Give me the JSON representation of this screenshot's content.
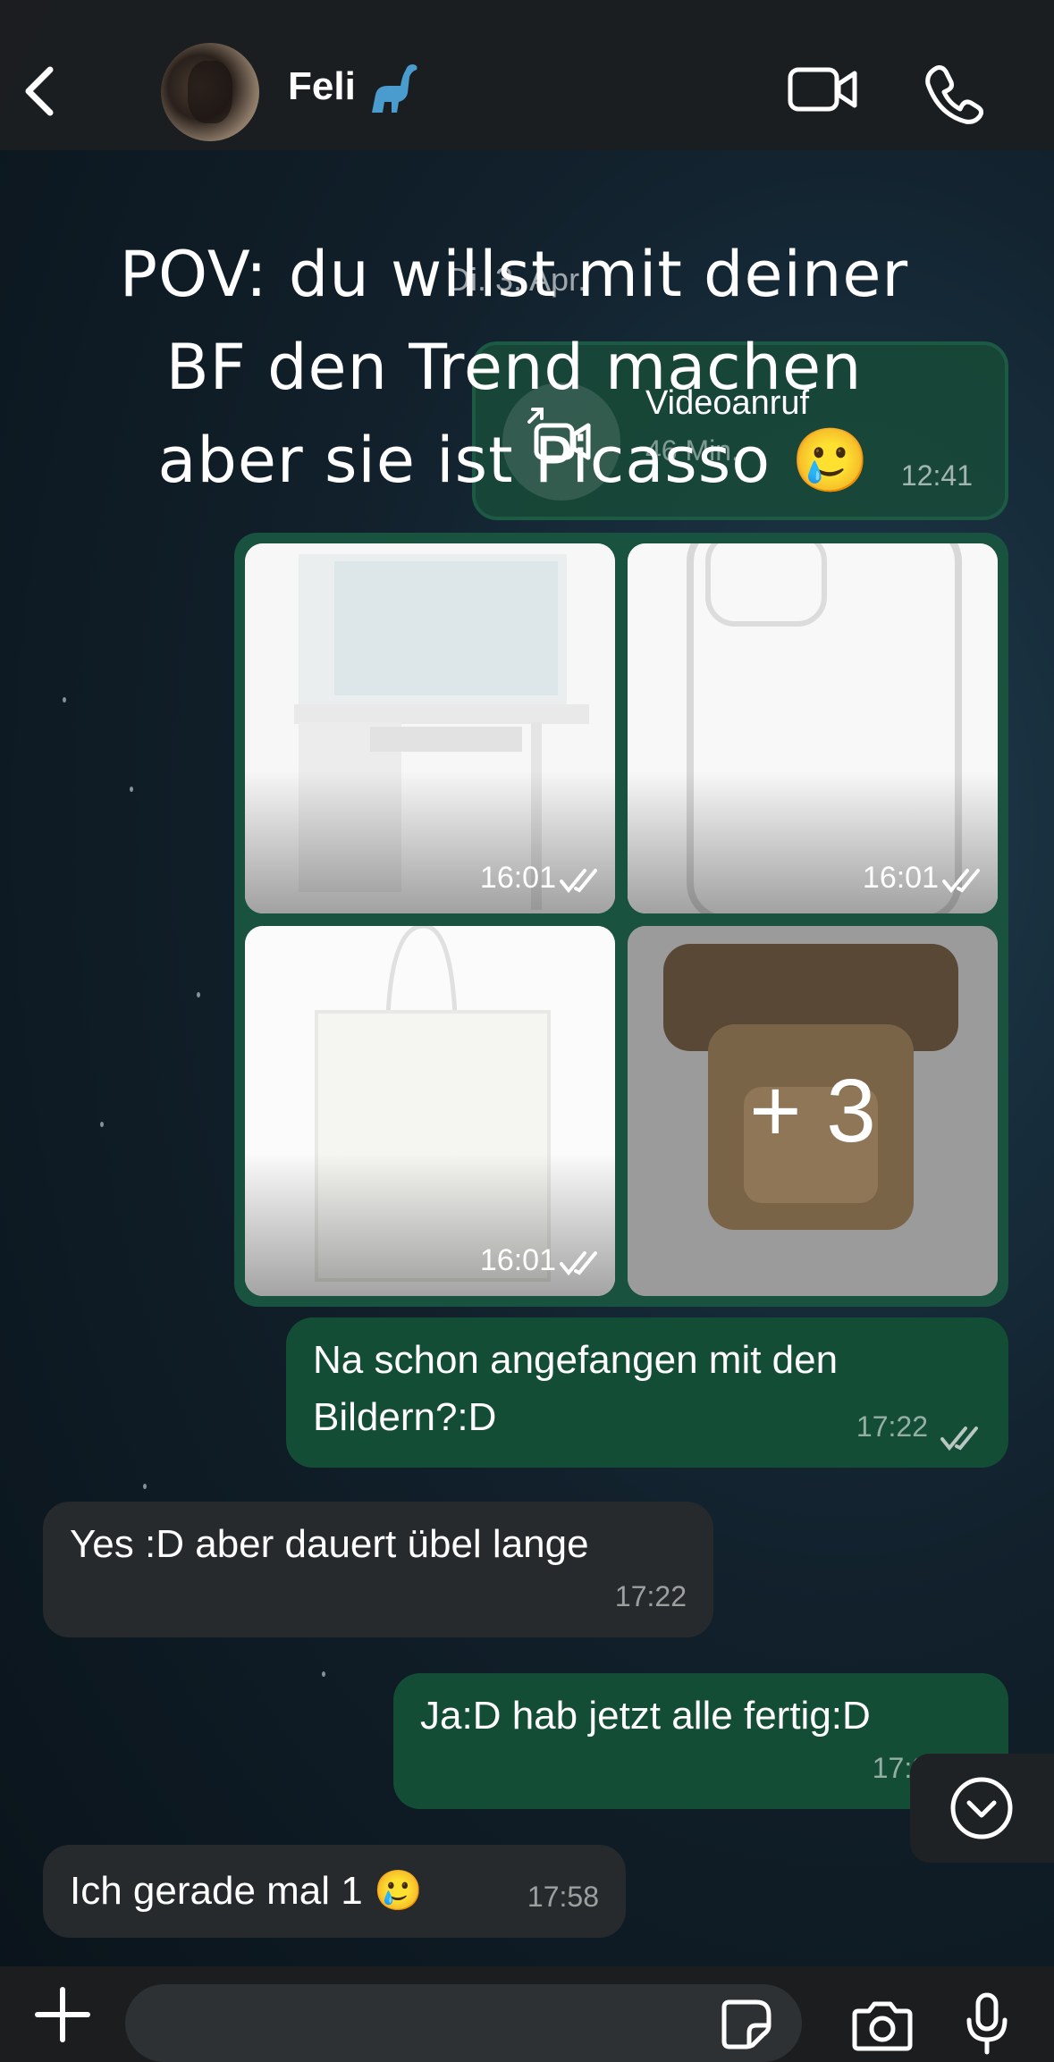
{
  "header": {
    "contact_name": "Feli",
    "contact_emoji": "sauropod"
  },
  "chat": {
    "overlay_text": "POV: du willst mit deiner BF den Trend machen aber sie ist Picasso 🥲",
    "date_chip": "Di. 3. Apr.",
    "video_call": {
      "title": "Videoanruf",
      "duration": "46 Min.",
      "time": "12:41"
    },
    "gallery": {
      "images": [
        {
          "label": "desk",
          "time": "16:01"
        },
        {
          "label": "phone case",
          "time": "16:01"
        },
        {
          "label": "tote bag",
          "time": "16:01"
        },
        {
          "label": "box",
          "more": "+ 3"
        }
      ]
    },
    "messages": [
      {
        "direction": "out",
        "text_line1": "Na schon angefangen mit den",
        "text_line2": "Bildern?:D",
        "time": "17:22"
      },
      {
        "direction": "in",
        "text": "Yes :D aber dauert übel lange",
        "time": "17:22"
      },
      {
        "direction": "out",
        "text": "Ja:D hab jetzt alle fertig:D",
        "time": "17:2"
      },
      {
        "direction": "in",
        "text": "Ich gerade mal 1 🥲",
        "time": "17:58"
      }
    ]
  },
  "footer": {
    "input_placeholder": ""
  },
  "colors": {
    "outgoing_bubble": "#144d36",
    "incoming_bubble": "#262a2c",
    "header_bg": "#1c1e20",
    "read_tick": "#b9c7c2"
  },
  "icons": [
    "back-chevron-icon",
    "video-call-icon",
    "phone-icon",
    "double-check-icon",
    "scroll-down-icon",
    "plus-icon",
    "sticker-icon",
    "camera-icon",
    "microphone-icon"
  ]
}
